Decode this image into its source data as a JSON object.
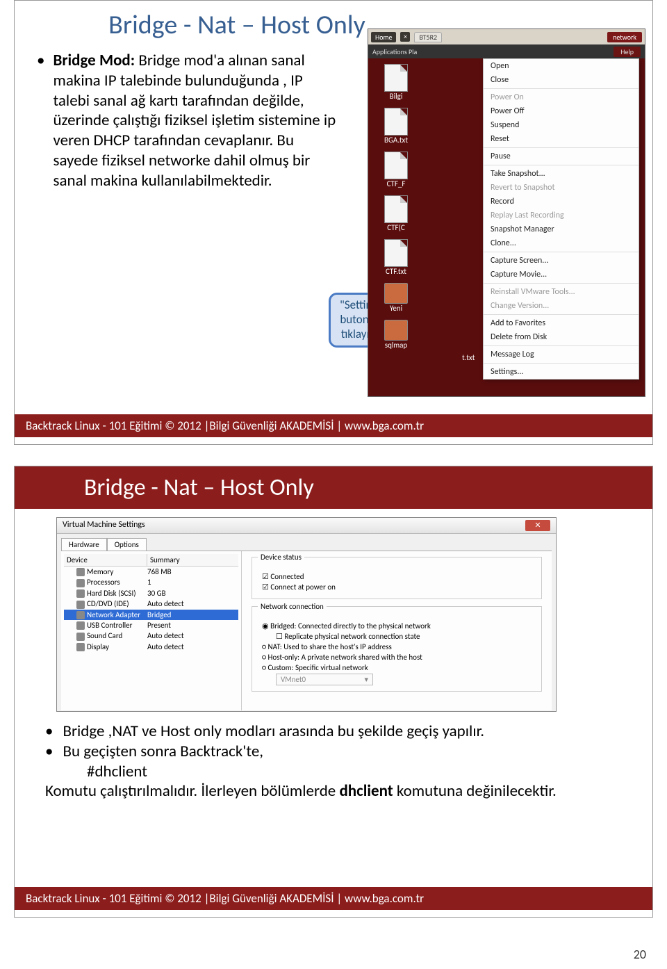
{
  "page_number": "20",
  "slide1": {
    "heading": "Bridge - Nat – Host Only",
    "bold_lead": "Bridge Mod:",
    "para": "Bridge mod'a alınan sanal makina IP talebinde bulunduğunda , IP talebi sanal ağ kartı tarafından değilde, üzerinde çalıştığı fiziksel işletim sistemine ip veren DHCP tarafından cevaplanır. Bu sayede fiziksel networke dahil olmuş bir sanal makina kullanılabilmektedir.",
    "callout": "\"Settings\" butonuna tıklayınız.",
    "footer": "Backtrack Linux - 101 Eğitimi © 2012 |Bilgi Güvenliği AKADEMİSİ | www.bga.com.tr",
    "shot": {
      "home": "Home",
      "tab": "BT5R2",
      "netbtn": "network",
      "app": "Applications  Pla",
      "help": "Help",
      "icons": [
        {
          "name": "Bilgi",
          "type": "file"
        },
        {
          "name": "BGA.txt",
          "type": "file"
        },
        {
          "name": "CTF_F",
          "type": "file"
        },
        {
          "name": "CTF(C",
          "type": "file"
        },
        {
          "name": "CTF.txt",
          "type": "file"
        },
        {
          "name": "Yeni",
          "type": "folder"
        },
        {
          "name": "sqlmap",
          "type": "folder"
        }
      ],
      "txtbit": "t.txt",
      "menu": [
        {
          "l": "Open"
        },
        {
          "l": "Close"
        },
        {
          "sep": true
        },
        {
          "l": "Power On",
          "g": true
        },
        {
          "l": "Power Off"
        },
        {
          "l": "Suspend"
        },
        {
          "l": "Reset"
        },
        {
          "sep": true
        },
        {
          "l": "Pause"
        },
        {
          "sep": true
        },
        {
          "l": "Take Snapshot..."
        },
        {
          "l": "Revert to Snapshot",
          "g": true
        },
        {
          "l": "Record"
        },
        {
          "l": "Replay Last Recording",
          "g": true
        },
        {
          "l": "Snapshot Manager"
        },
        {
          "l": "Clone..."
        },
        {
          "sep": true
        },
        {
          "l": "Capture Screen..."
        },
        {
          "l": "Capture Movie..."
        },
        {
          "sep": true
        },
        {
          "l": "Reinstall VMware Tools...",
          "g": true
        },
        {
          "l": "Change Version...",
          "g": true
        },
        {
          "sep": true
        },
        {
          "l": "Add to Favorites"
        },
        {
          "l": "Delete from Disk"
        },
        {
          "sep": true
        },
        {
          "l": "Message Log"
        },
        {
          "sep": true
        },
        {
          "l": "Settings..."
        }
      ]
    }
  },
  "slide2": {
    "title": "Bridge - Nat – Host Only",
    "footer": "Backtrack Linux - 101 Eğitimi © 2012 |Bilgi Güvenliği AKADEMİSİ | www.bga.com.tr",
    "win_title": "Virtual Machine Settings",
    "tabs": [
      "Hardware",
      "Options"
    ],
    "cols": [
      "Device",
      "Summary"
    ],
    "rows": [
      {
        "d": "Memory",
        "s": "768 MB"
      },
      {
        "d": "Processors",
        "s": "1"
      },
      {
        "d": "Hard Disk (SCSI)",
        "s": "30 GB"
      },
      {
        "d": "CD/DVD (IDE)",
        "s": "Auto detect"
      },
      {
        "d": "Network Adapter",
        "s": "Bridged",
        "sel": true
      },
      {
        "d": "USB Controller",
        "s": "Present"
      },
      {
        "d": "Sound Card",
        "s": "Auto detect"
      },
      {
        "d": "Display",
        "s": "Auto detect"
      }
    ],
    "devstatus_label": "Device status",
    "connected": "Connected",
    "connect_power": "Connect at power on",
    "netconn_label": "Network connection",
    "bridged": "Bridged: Connected directly to the physical network",
    "replicate": "Replicate physical network connection state",
    "nat": "NAT: Used to share the host's IP address",
    "hostonly": "Host-only: A private network shared with the host",
    "custom": "Custom: Specific virtual network",
    "vmnet": "VMnet0",
    "b1": "Bridge ,NAT ve Host only modları arasında bu şekilde geçiş yapılır.",
    "b2a": "Bu geçişten sonra Backtrack'te,",
    "b2b": "#dhclient",
    "b2c_pre": "Komutu çalıştırılmalıdır. İlerleyen bölümlerde ",
    "b2c_bold": "dhclient",
    "b2c_post": " komutuna değinilecektir."
  }
}
